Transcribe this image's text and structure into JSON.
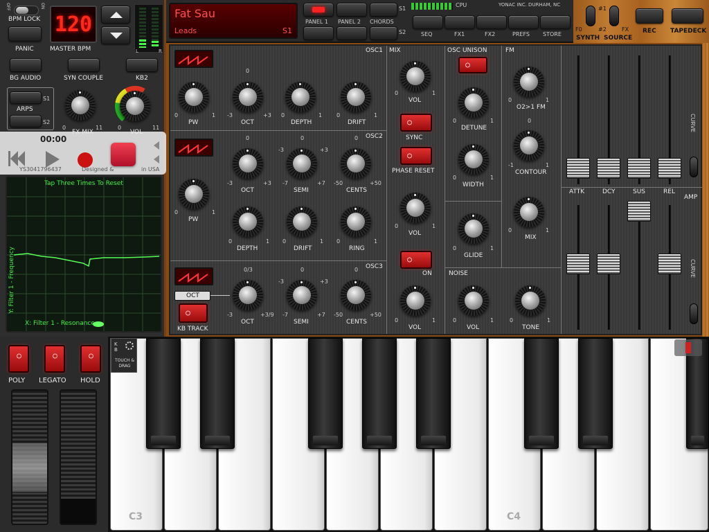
{
  "toolbar_left": {
    "off": "OFF",
    "on": "ON",
    "bpm_lock": "BPM LOCK",
    "bpm_value": "120",
    "panic": "PANIC",
    "master_bpm": "MASTER BPM",
    "bg_audio": "BG AUDIO",
    "syn_couple": "SYN COUPLE",
    "kb2": "KB2",
    "arps": "ARPS",
    "s1": "S1",
    "s2": "S2",
    "fx_mix": "FX MIX",
    "vol": "VOL",
    "zero": "0",
    "eleven": "11",
    "meter_l": "L",
    "meter_r": "R"
  },
  "preset": {
    "name": "Fat Sau",
    "category": "Leads",
    "slot": "S1"
  },
  "nav": {
    "panel1": "PANEL 1",
    "panel2": "PANEL 2",
    "chords": "CHORDS",
    "seq": "SEQ",
    "fx1": "FX1",
    "fx2": "FX2",
    "prefs": "PREFS",
    "store": "STORE",
    "s1": "S1",
    "s2": "S2"
  },
  "cpu": {
    "label": "CPU",
    "brand": "YONAC INC. DURHAM, NC"
  },
  "right_top": {
    "f0": "F0",
    "synth": "SYNTH",
    "n1": "#1",
    "n2": "#2",
    "fx": "FX",
    "source": "SOURCE",
    "rec": "REC",
    "tapedeck": "TAPEDECK"
  },
  "recorder": {
    "time": "00:00",
    "serial": "YS3041796437",
    "designed": "Designed &",
    "usa": "in USA"
  },
  "scope": {
    "tap": "Tap Three Times To Reset",
    "y_axis": "Y: Filter 1 - Frequency",
    "x_axis": "X: Filter 1 - Resonance"
  },
  "osc1": {
    "title": "OSC1",
    "pw": "PW",
    "oct": "OCT",
    "depth": "DEPTH",
    "drift": "DRIFT"
  },
  "osc2": {
    "title": "OSC2",
    "pw": "PW",
    "oct": "OCT",
    "semi": "SEMI",
    "cents": "CENTS",
    "depth": "DEPTH",
    "drift": "DRIFT",
    "ring": "RING"
  },
  "osc3": {
    "title": "OSC3",
    "oct_btn": "OCT",
    "kb_track": "KB TRACK",
    "oct": "OCT",
    "semi": "SEMI",
    "cents": "CENTS",
    "oct_range": "0/3",
    "oct_hi": "+3/9"
  },
  "mix": {
    "title": "MIX",
    "vol": "VOL",
    "sync": "SYNC",
    "phase_reset": "PHASE RESET",
    "vol2": "VOL",
    "on": "ON",
    "vol3": "VOL"
  },
  "unison": {
    "title": "OSC UNISON",
    "detune": "DETUNE",
    "width": "WIDTH",
    "glide": "GLIDE"
  },
  "noise": {
    "title": "NOISE",
    "vol": "VOL",
    "tone": "TONE"
  },
  "fm": {
    "title": "FM",
    "o2o1": "O2>1 FM",
    "contour": "CONTOUR",
    "mix": "MIX"
  },
  "env": {
    "attk": "ATTK",
    "dcy": "DCY",
    "sus": "SUS",
    "rel": "REL",
    "curve": "CURVE",
    "amp": "AMP"
  },
  "scale": {
    "zero": "0",
    "one": "1",
    "m3": "-3",
    "p3": "+3",
    "m7": "-7",
    "p7": "+7",
    "m50": "-50",
    "p50": "+50",
    "m1": "-1"
  },
  "performance": {
    "poly": "POLY",
    "legato": "LEGATO",
    "hold": "HOLD",
    "kb": "K B",
    "touch_drag": "TOUCH & DRAG"
  },
  "keyboard": {
    "c3": "C3",
    "c4": "C4"
  }
}
